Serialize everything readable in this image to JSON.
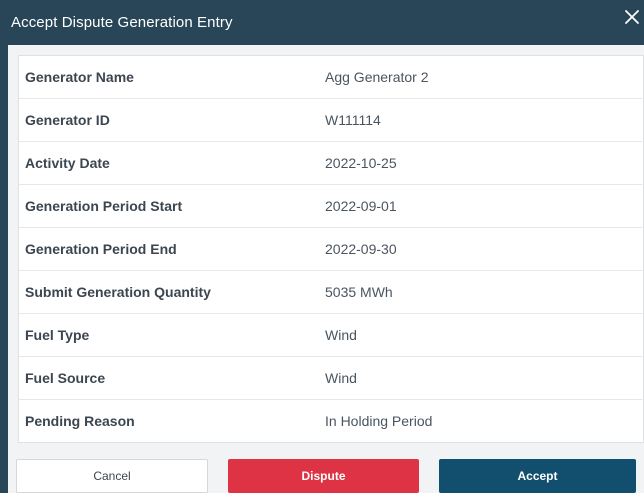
{
  "dialog": {
    "title": "Accept Dispute Generation Entry",
    "close_icon": "close-icon"
  },
  "details": [
    {
      "label": "Generator Name",
      "value": "Agg Generator 2"
    },
    {
      "label": "Generator ID",
      "value": "W111114"
    },
    {
      "label": "Activity Date",
      "value": "2022-10-25"
    },
    {
      "label": "Generation Period Start",
      "value": "2022-09-01"
    },
    {
      "label": "Generation Period End",
      "value": "2022-09-30"
    },
    {
      "label": "Submit Generation Quantity",
      "value": "5035 MWh"
    },
    {
      "label": "Fuel Type",
      "value": "Wind"
    },
    {
      "label": "Fuel Source",
      "value": "Wind"
    },
    {
      "label": "Pending Reason",
      "value": "In Holding Period"
    }
  ],
  "actions": {
    "cancel_label": "Cancel",
    "dispute_label": "Dispute",
    "accept_label": "Accept"
  },
  "colors": {
    "header_bg": "#284657",
    "dispute": "#de3344",
    "accept": "#124e6e"
  }
}
